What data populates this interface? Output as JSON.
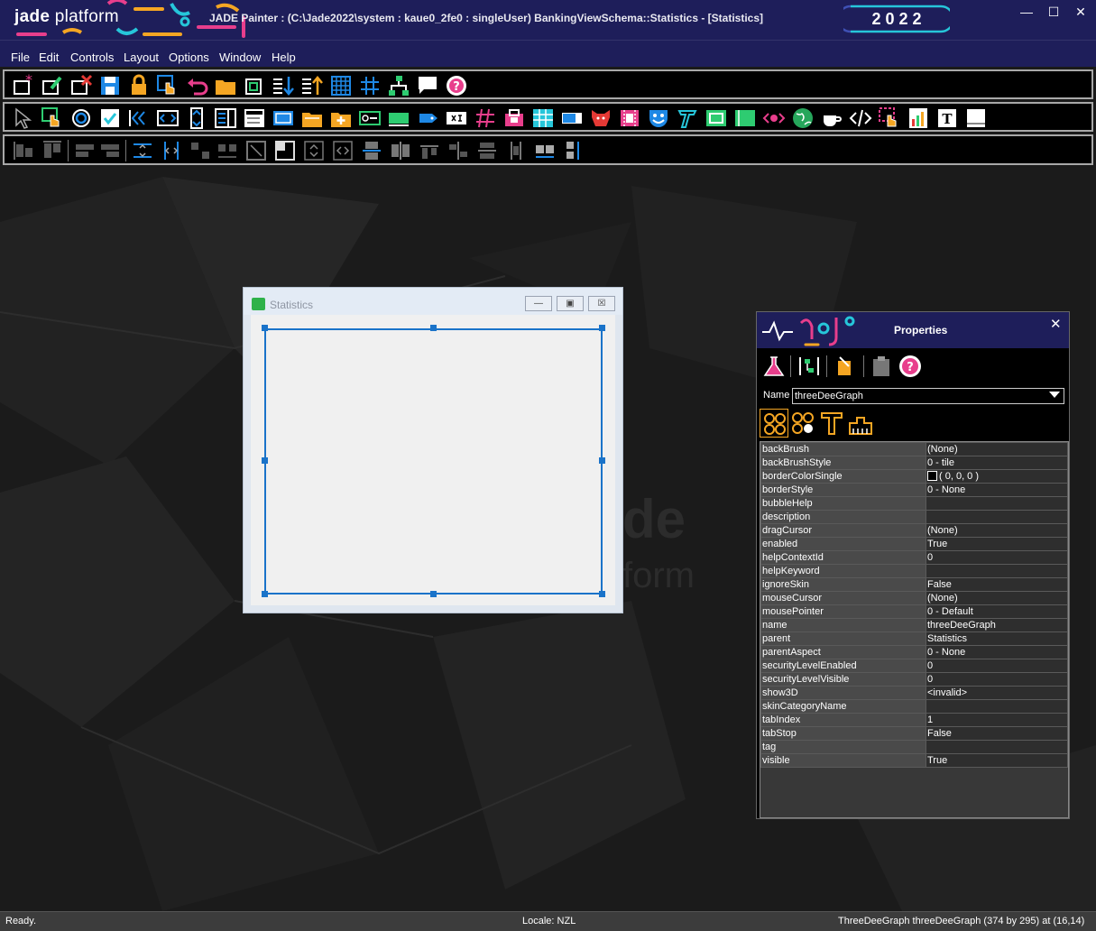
{
  "app": {
    "logo_bold": "jade",
    "logo_light": " platform",
    "window_title": "JADE Painter : (C:\\Jade2022\\system : kaue0_2fe0 : singleUser) BankingViewSchema::Statistics - [Statistics]",
    "version_badge": "2 0 2 2"
  },
  "menu": [
    {
      "label": "File"
    },
    {
      "label": "Edit"
    },
    {
      "label": "Controls"
    },
    {
      "label": "Layout"
    },
    {
      "label": "Options"
    },
    {
      "label": "Window"
    },
    {
      "label": "Help"
    }
  ],
  "workspace": {
    "watermark_line1": "de",
    "watermark_line2": "form"
  },
  "child_window": {
    "title": "Statistics"
  },
  "properties": {
    "title": "Properties",
    "close": "✕",
    "name_label": "Name",
    "name_value": "threeDeeGraph",
    "rows": [
      {
        "key": "backBrush",
        "value": "(None)"
      },
      {
        "key": "backBrushStyle",
        "value": "0 - tile"
      },
      {
        "key": "borderColorSingle",
        "value": "( 0, 0, 0 )",
        "swatch": "#000000"
      },
      {
        "key": "borderStyle",
        "value": "0 - None"
      },
      {
        "key": "bubbleHelp",
        "value": ""
      },
      {
        "key": "description",
        "value": ""
      },
      {
        "key": "dragCursor",
        "value": "(None)"
      },
      {
        "key": "enabled",
        "value": "True"
      },
      {
        "key": "helpContextId",
        "value": "0"
      },
      {
        "key": "helpKeyword",
        "value": ""
      },
      {
        "key": "ignoreSkin",
        "value": "False"
      },
      {
        "key": "mouseCursor",
        "value": "(None)"
      },
      {
        "key": "mousePointer",
        "value": " 0 - Default"
      },
      {
        "key": "name",
        "value": "threeDeeGraph"
      },
      {
        "key": "parent",
        "value": "Statistics"
      },
      {
        "key": "parentAspect",
        "value": " 0 - None"
      },
      {
        "key": "securityLevelEnabled",
        "value": "0"
      },
      {
        "key": "securityLevelVisible",
        "value": "0"
      },
      {
        "key": "show3D",
        "value": "<invalid>"
      },
      {
        "key": "skinCategoryName",
        "value": ""
      },
      {
        "key": "tabIndex",
        "value": "1"
      },
      {
        "key": "tabStop",
        "value": "False"
      },
      {
        "key": "tag",
        "value": ""
      },
      {
        "key": "visible",
        "value": "True"
      }
    ]
  },
  "status": {
    "left": "Ready.",
    "center": "Locale: NZL",
    "right": "ThreeDeeGraph threeDeeGraph (374 by 295) at (16,14)"
  }
}
